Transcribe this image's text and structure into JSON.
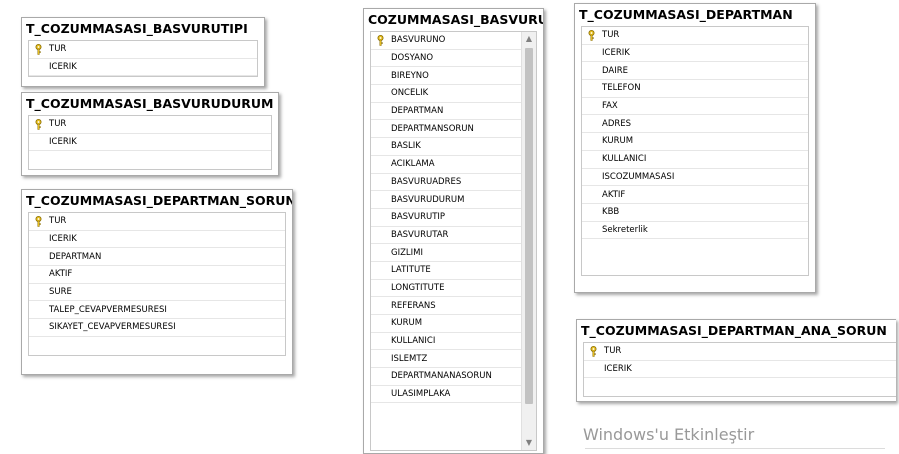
{
  "tables": {
    "basvurutipi": {
      "title": "T_COZUMMASASI_BASVURUTIPI",
      "fields": [
        "TUR",
        "ICERIK"
      ]
    },
    "basvurudurum": {
      "title": "T_COZUMMASASI_BASVURUDURUM",
      "fields": [
        "TUR",
        "ICERIK"
      ]
    },
    "departman_sorun": {
      "title": "T_COZUMMASASI_DEPARTMAN_SORUN",
      "fields": [
        "TUR",
        "ICERIK",
        "DEPARTMAN",
        "AKTIF",
        "SURE",
        "TALEP_CEVAPVERMESURESI",
        "SIKAYET_CEVAPVERMESURESI"
      ]
    },
    "basvuru": {
      "title": "COZUMMASASI_BASVURU",
      "fields": [
        "BASVURUNO",
        "DOSYANO",
        "BIREYNO",
        "ONCELIK",
        "DEPARTMAN",
        "DEPARTMANSORUN",
        "BASLIK",
        "ACIKLAMA",
        "BASVURUADRES",
        "BASVURUDURUM",
        "BASVURUTIP",
        "BASVURUTAR",
        "GIZLIMI",
        "LATITUTE",
        "LONGTITUTE",
        "REFERANS",
        "KURUM",
        "KULLANICI",
        "ISLEMTZ",
        "DEPARTMANANASORUN",
        "ULASIMPLAKA"
      ]
    },
    "departman": {
      "title": "T_COZUMMASASI_DEPARTMAN",
      "fields": [
        "TUR",
        "ICERIK",
        "DAIRE",
        "TELEFON",
        "FAX",
        "ADRES",
        "KURUM",
        "KULLANICI",
        "ISCOZUMMASASI",
        "AKTIF",
        "KBB",
        "Sekreterlik"
      ]
    },
    "departman_ana_sorun": {
      "title": "T_COZUMMASASI_DEPARTMAN_ANA_SORUN",
      "fields": [
        "TUR",
        "ICERIK"
      ]
    }
  },
  "watermark": "Windows'u Etkinleştir",
  "icons": {
    "primary_key": "key-icon",
    "scroll_up": "scroll-up-arrow-icon",
    "scroll_down": "scroll-down-arrow-icon"
  },
  "colors": {
    "key_gold": "#e8c020",
    "border": "#a9a9a9",
    "watermark": "#999999"
  }
}
